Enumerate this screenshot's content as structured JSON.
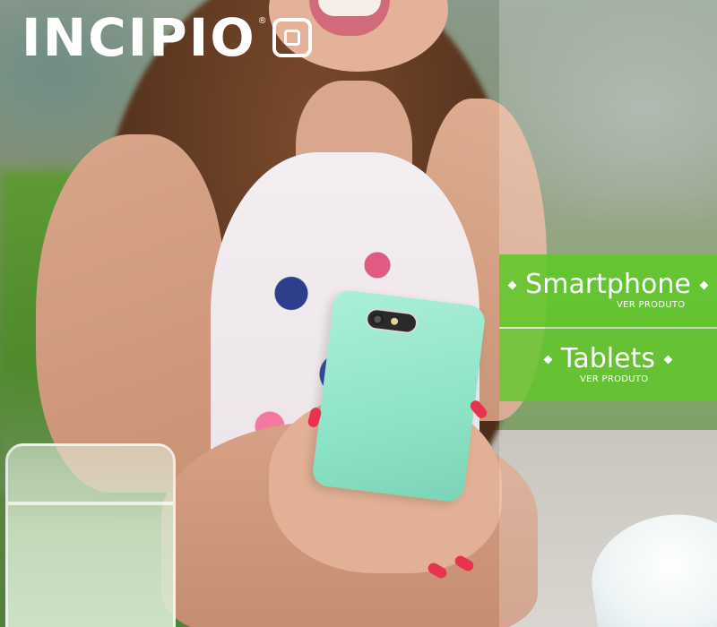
{
  "brand": {
    "name": "INCIPIO",
    "registered_mark": "®",
    "logo_icon": "incipio-square-mark-icon"
  },
  "menu": {
    "items": [
      {
        "label": "Smartphone",
        "sublabel": "VER PRODUTO",
        "icon": "diamond-bullet-icon"
      },
      {
        "label": "Tablets",
        "sublabel": "VER PRODUTO",
        "icon": "diamond-bullet-icon"
      }
    ]
  },
  "colors": {
    "menu_green": "#5fc828",
    "text": "#ffffff",
    "phone_case_mint": "#8de3c6"
  }
}
